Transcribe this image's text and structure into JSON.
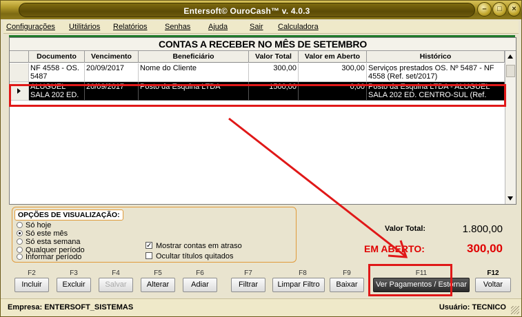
{
  "window": {
    "title": "Entersoft© OuroCash™ v. 4.0.3",
    "title_buttons": [
      "minimize-icon",
      "maximize-icon",
      "close-icon"
    ]
  },
  "menu": {
    "items": [
      "Configurações",
      "Utilitários",
      "Relatórios",
      "Senhas",
      "Ajuda",
      "Sair",
      "Calculadora"
    ]
  },
  "grid": {
    "title": "CONTAS A RECEBER NO MÊS DE SETEMBRO",
    "columns": [
      "Documento",
      "Vencimento",
      "Beneficiário",
      "Valor Total",
      "Valor em Aberto",
      "Histórico"
    ],
    "rows": [
      {
        "documento": "NF 4558 - OS. 5487",
        "vencimento": "20/09/2017",
        "beneficiario": "Nome do Cliente",
        "valor_total": "300,00",
        "valor_aberto": "300,00",
        "historico": "Serviços prestados OS. Nº 5487 - NF 4558 (Ref. set/2017)"
      },
      {
        "documento": "ALUGUEL SALA 202 ED.",
        "vencimento": "20/09/2017",
        "beneficiario": "Posto da Esquina LTDA",
        "valor_total": "1500,00",
        "valor_aberto": "0,00",
        "historico": "Posto da Esquina LTDA - ALUGUEL SALA 202 ED. CENTRO-SUL (Ref.",
        "selected": true
      }
    ]
  },
  "options": {
    "title": "OPÇÕES DE VISUALIZAÇÃO:",
    "radios": [
      {
        "label": "Só hoje",
        "checked": false
      },
      {
        "label": "Só este mês",
        "checked": true
      },
      {
        "label": "Só esta semana",
        "checked": false
      },
      {
        "label": "Qualquer período",
        "checked": false
      },
      {
        "label": "Informar período",
        "checked": false
      }
    ],
    "checkboxes": [
      {
        "label": "Mostrar contas em atraso",
        "checked": true
      },
      {
        "label": "Ocultar títulos quitados",
        "checked": false
      }
    ]
  },
  "totals": {
    "valor_total_label": "Valor Total:",
    "valor_total": "1.800,00",
    "em_aberto_label": "EM ABERTO:",
    "em_aberto": "300,00"
  },
  "function_keys": [
    {
      "key": "F2",
      "label": "Incluir",
      "enabled": true
    },
    {
      "key": "F3",
      "label": "Excluir",
      "enabled": true
    },
    {
      "key": "F4",
      "label": "Salvar",
      "enabled": false
    },
    {
      "key": "F5",
      "label": "Alterar",
      "enabled": true
    },
    {
      "key": "F6",
      "label": "Adiar",
      "enabled": true
    },
    {
      "key": "F7",
      "label": "Filtrar",
      "enabled": true
    },
    {
      "key": "F8",
      "label": "Limpar Filtro",
      "enabled": true
    },
    {
      "key": "F9",
      "label": "Baixar",
      "enabled": true
    },
    {
      "key": "F11",
      "label": "Ver Pagamentos / Estornar",
      "enabled": true
    },
    {
      "key": "F12",
      "label": "Voltar",
      "enabled": true
    }
  ],
  "status": {
    "empresa": "Empresa: ENTERSOFT_SISTEMAS",
    "usuario": "Usuário: TECNICO"
  },
  "colors": {
    "title_gold": "#8e7a1c",
    "panel_bg": "#e9e4cf",
    "accent_green": "#1f7a2a",
    "annotation_red": "#e01818",
    "em_aberto_red": "#e00000"
  }
}
